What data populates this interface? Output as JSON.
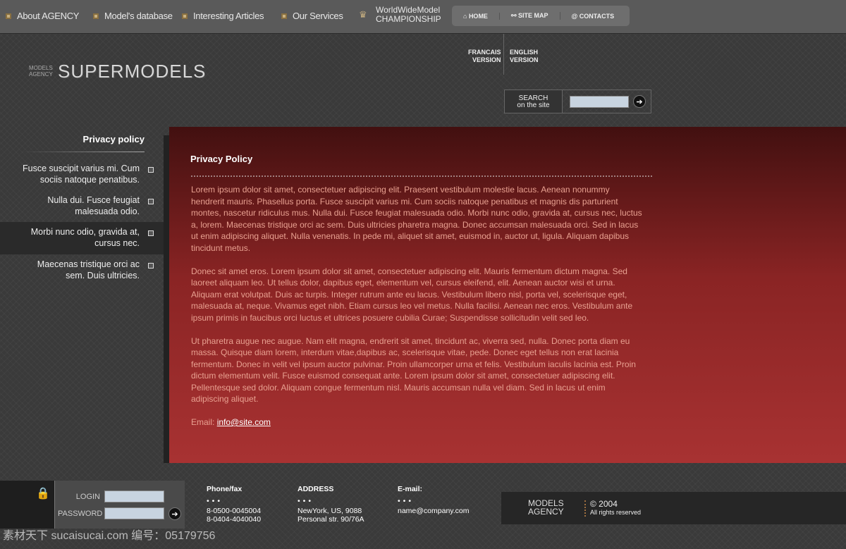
{
  "nav": [
    "About AGENCY",
    "Model's database",
    "Interesting Articles",
    "Our Services"
  ],
  "championship": [
    "WorldWideModel",
    "CHAMPIONSHIP"
  ],
  "util": [
    "HOME",
    "SITE MAP",
    "CONTACTS"
  ],
  "logo": {
    "small": [
      "MODELS",
      "AGENCY"
    ],
    "main": "SUPERMODELS"
  },
  "lang": [
    [
      "FRANCAIS",
      "VERSION"
    ],
    [
      "ENGLISH",
      "VERSION"
    ]
  ],
  "search": {
    "label1": "SEARCH",
    "label2": "on the site"
  },
  "sidebar": {
    "title": "Privacy policy",
    "items": [
      [
        "Fusce suscipit varius mi. Cum",
        "sociis natoque penatibus."
      ],
      [
        "Nulla dui. Fusce feugiat",
        "malesuada odio."
      ],
      [
        "Morbi nunc odio, gravida at,",
        "cursus nec."
      ],
      [
        "Maecenas tristique orci ac",
        "sem. Duis ultricies."
      ]
    ]
  },
  "main": {
    "title": "Privacy Policy",
    "paragraphs": [
      "Lorem ipsum dolor sit amet, consectetuer adipiscing elit. Praesent vestibulum molestie lacus. Aenean nonummy hendrerit mauris. Phasellus porta. Fusce suscipit varius mi. Cum sociis natoque penatibus et magnis dis parturient montes, nascetur ridiculus mus. Nulla dui. Fusce feugiat malesuada odio. Morbi nunc odio, gravida at, cursus nec, luctus a, lorem. Maecenas tristique orci ac sem. Duis ultricies pharetra magna. Donec accumsan malesuada orci. Sed in lacus ut enim adipiscing aliquet. Nulla venenatis. In pede mi, aliquet sit amet, euismod in, auctor ut, ligula. Aliquam dapibus tincidunt metus.",
      "Donec sit amet eros. Lorem ipsum dolor sit amet, consectetuer adipiscing elit. Mauris fermentum dictum magna. Sed laoreet aliquam leo. Ut tellus dolor, dapibus eget, elementum vel, cursus eleifend, elit. Aenean auctor wisi et urna. Aliquam erat volutpat. Duis ac turpis. Integer rutrum ante eu lacus. Vestibulum libero nisl, porta vel, scelerisque eget, malesuada at, neque. Vivamus eget nibh. Etiam cursus leo vel metus. Nulla facilisi. Aenean nec eros. Vestibulum ante ipsum primis in faucibus orci luctus et ultrices posuere cubilia Curae; Suspendisse sollicitudin velit sed leo.",
      "Ut pharetra augue nec augue. Nam elit magna, endrerit sit amet, tincidunt ac, viverra sed, nulla. Donec porta diam eu massa. Quisque diam lorem, interdum vitae,dapibus ac, scelerisque vitae, pede. Donec eget tellus non erat lacinia fermentum. Donec in velit vel ipsum auctor pulvinar. Proin ullamcorper urna et felis. Vestibulum iaculis lacinia est. Proin dictum elementum velit. Fusce euismod consequat ante. Lorem ipsum dolor sit amet, consectetuer adipiscing elit. Pellentesque sed dolor. Aliquam congue fermentum nisl. Mauris accumsan nulla vel diam. Sed in lacus ut enim adipiscing aliquet."
    ],
    "email_label": "Email:",
    "email": "info@site.com"
  },
  "login": {
    "login": "LOGIN",
    "password": "PASSWORD"
  },
  "footer": {
    "phone": {
      "title": "Phone/fax",
      "l1": "8-0500-0045004",
      "l2": "8-0404-4040040"
    },
    "address": {
      "title": "ADDRESS",
      "l1": "NewYork, US, 9088",
      "l2": "Personal str. 90/76A"
    },
    "email": {
      "title": "E-mail:",
      "l1": "name@company.com"
    },
    "logo": [
      "MODELS",
      "AGENCY"
    ],
    "copy": "© 2004",
    "rights": "All rights reserved"
  },
  "watermark": "素材天下 sucaisucai.com  编号：05179756",
  "colors": {
    "panel": "#a83232",
    "text": "#e8a090"
  }
}
